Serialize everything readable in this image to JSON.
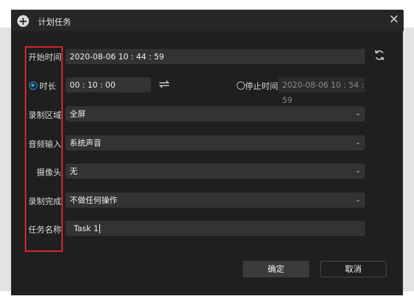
{
  "window": {
    "title": "计划任务",
    "close_glyph": "✕",
    "add_glyph": "+"
  },
  "form": {
    "start_time": {
      "label": "开始时间",
      "value": "2020-08-06 10 : 44 : 59"
    },
    "duration": {
      "label": "时长",
      "value": "00 : 10 : 00",
      "selected": true
    },
    "stop_time": {
      "label": "停止时间",
      "value": "2020-08-06 10 : 54 : 59",
      "selected": false
    },
    "record_area": {
      "label": "录制区域",
      "value": "全屏"
    },
    "audio_input": {
      "label": "音频输入",
      "value": "系统声音"
    },
    "camera": {
      "label": "摄像头",
      "value": "无"
    },
    "on_complete": {
      "label": "录制完成",
      "value": "不做任何操作"
    },
    "task_name": {
      "label": "任务名称",
      "value": "Task 1"
    }
  },
  "buttons": {
    "ok": "确定",
    "cancel": "取消"
  },
  "colors": {
    "accent": "#2aa2e6",
    "highlight_box": "#e0262b",
    "dialog_bg": "#1f1f1f",
    "field_bg": "#333333"
  },
  "icons": {
    "refresh": "refresh-icon",
    "swap": "swap-icon",
    "dropdown": "chevron-down-icon"
  }
}
